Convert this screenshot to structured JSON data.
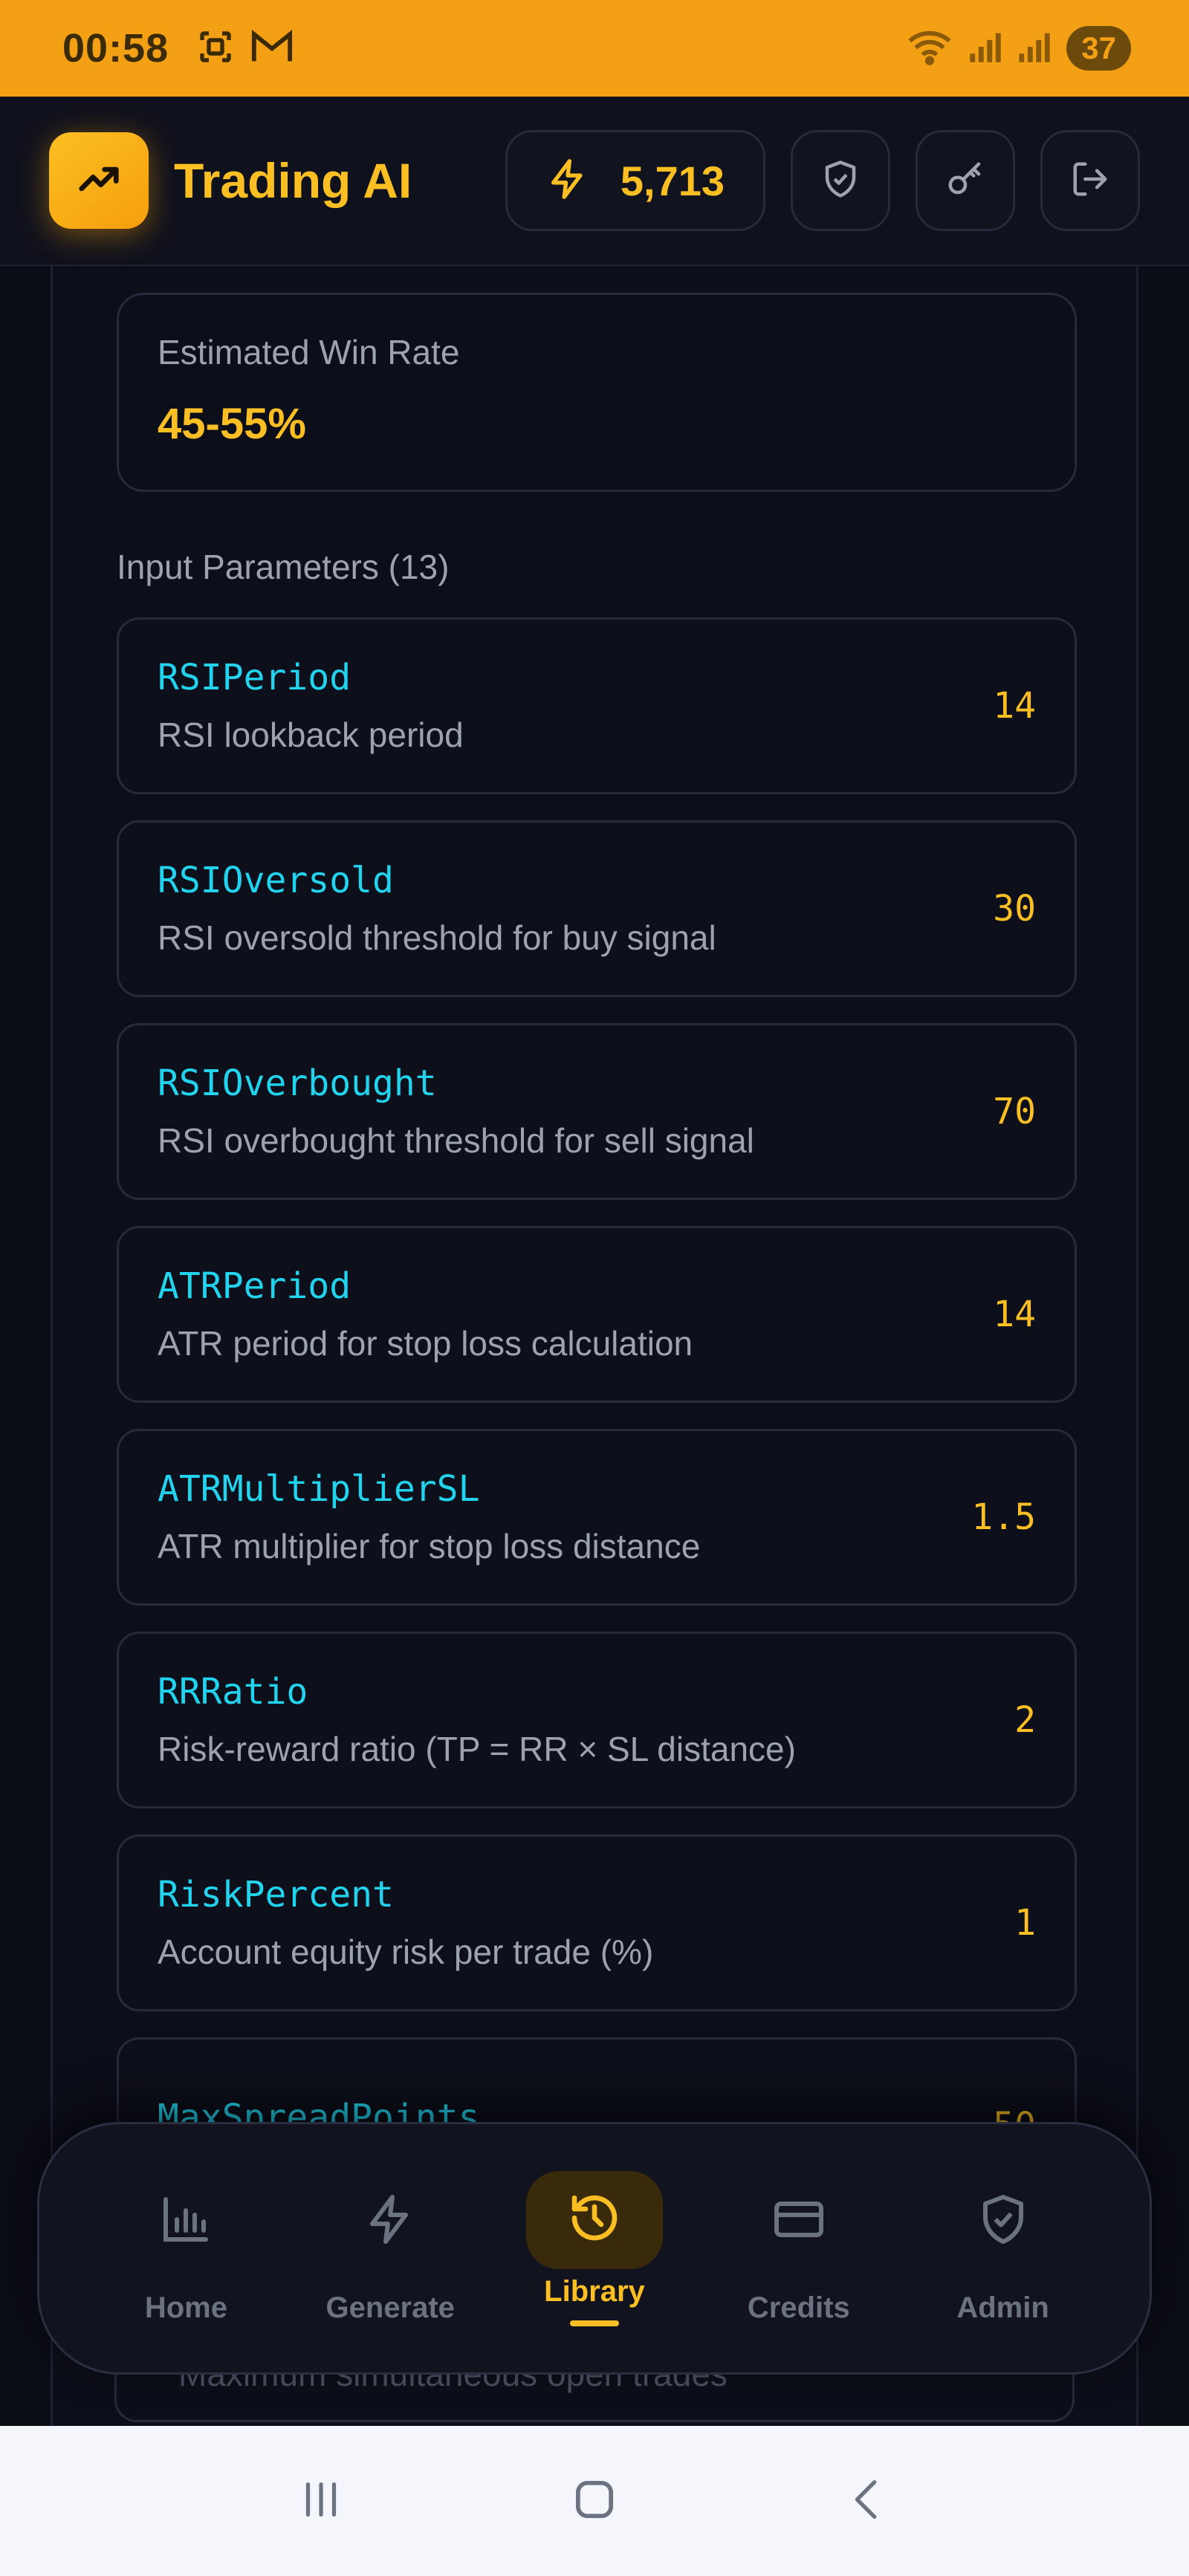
{
  "status_bar": {
    "time": "00:58",
    "battery": "37",
    "icons_left": [
      "screenshot-icon",
      "gmail-icon"
    ],
    "icons_right": [
      "wifi-icon",
      "signal-icon",
      "signal-icon"
    ]
  },
  "header": {
    "app_name": "Trading AI",
    "credits": "5,713",
    "buttons": [
      "shield-check-icon",
      "key-icon",
      "logout-icon"
    ]
  },
  "strategy": {
    "win_rate_label": "Estimated Win Rate",
    "win_rate_value": "45-55%",
    "params_title": "Input Parameters (13)",
    "params": [
      {
        "name": "RSIPeriod",
        "desc": "RSI lookback period",
        "value": "14"
      },
      {
        "name": "RSIOversold",
        "desc": "RSI oversold threshold for buy signal",
        "value": "30"
      },
      {
        "name": "RSIOverbought",
        "desc": "RSI overbought threshold for sell signal",
        "value": "70"
      },
      {
        "name": "ATRPeriod",
        "desc": "ATR period for stop loss calculation",
        "value": "14"
      },
      {
        "name": "ATRMultiplierSL",
        "desc": "ATR multiplier for stop loss distance",
        "value": "1.5"
      },
      {
        "name": "RRRatio",
        "desc": "Risk-reward ratio (TP = RR × SL distance)",
        "value": "2"
      },
      {
        "name": "RiskPercent",
        "desc": "Account equity risk per trade (%)",
        "value": "1"
      },
      {
        "name": "MaxSpreadPoints",
        "desc": "",
        "value": "50"
      }
    ],
    "peek_desc": "Maximum simultaneous open trades"
  },
  "bottom_nav": {
    "items": [
      {
        "label": "Home",
        "icon": "bar-chart-icon",
        "active": false
      },
      {
        "label": "Generate",
        "icon": "lightning-icon",
        "active": false
      },
      {
        "label": "Library",
        "icon": "history-icon",
        "active": true
      },
      {
        "label": "Credits",
        "icon": "credit-card-icon",
        "active": false
      },
      {
        "label": "Admin",
        "icon": "shield-check-icon",
        "active": false
      }
    ]
  },
  "colors": {
    "accent": "#fbbf24",
    "status_bar": "#f4a014",
    "param_name": "#22d3ee",
    "background": "#0b0d17"
  }
}
